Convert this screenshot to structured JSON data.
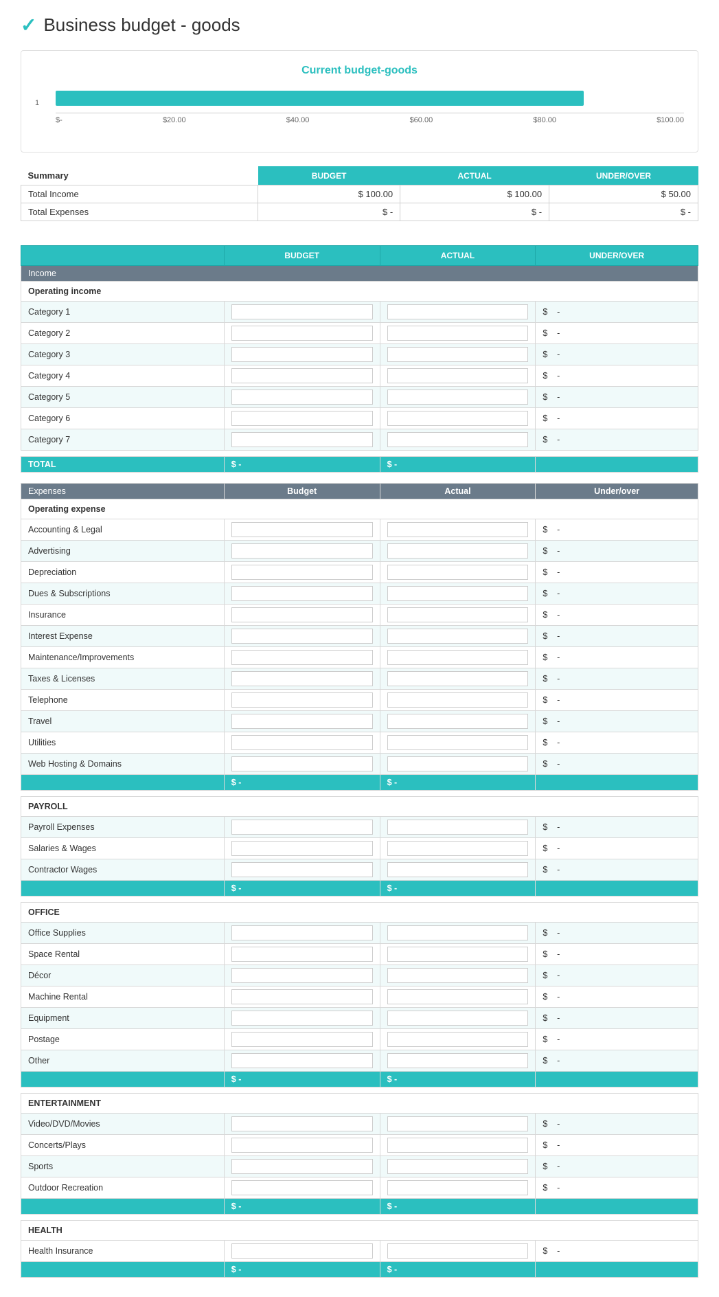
{
  "page": {
    "title": "Business budget - goods",
    "logo_icon": "✓"
  },
  "chart": {
    "title": "Current budget-goods",
    "bar_width_pct": 84,
    "y_label": "1",
    "x_labels": [
      "$-",
      "$20.00",
      "$40.00",
      "$60.00",
      "$80.00",
      "$100.00"
    ]
  },
  "summary": {
    "headers": [
      "",
      "BUDGET",
      "ACTUAL",
      "UNDER/OVER"
    ],
    "label": "Summary",
    "rows": [
      {
        "label": "Total Income",
        "budget": "$ 100.00",
        "actual": "$ 100.00",
        "under_over": "$ 50.00"
      },
      {
        "label": "Total Expenses",
        "budget": "$   -",
        "actual": "$   -",
        "under_over": "$   -"
      }
    ]
  },
  "income_table": {
    "headers": [
      "",
      "BUDGET",
      "ACTUAL",
      "UNDER/OVER"
    ],
    "section_label": "Income",
    "sub_header": "Operating income",
    "categories": [
      "Category 1",
      "Category 2",
      "Category 3",
      "Category 4",
      "Category 5",
      "Category 6",
      "Category 7"
    ],
    "total_label": "TOTAL",
    "total_budget": "$ -",
    "total_actual": "$ -"
  },
  "expenses_table": {
    "section_label": "Expenses",
    "col_budget": "Budget",
    "col_actual": "Actual",
    "col_under_over": "Under/over",
    "groups": [
      {
        "header": "Operating expense",
        "items": [
          "Accounting & Legal",
          "Advertising",
          "Depreciation",
          "Dues & Subscriptions",
          "Insurance",
          "Interest Expense",
          "Maintenance/Improvements",
          "Taxes & Licenses",
          "Telephone",
          "Travel",
          "Utilities",
          "Web Hosting & Domains"
        ],
        "total_budget": "$ -",
        "total_actual": "$ -"
      },
      {
        "header": "PAYROLL",
        "items": [
          "Payroll Expenses",
          "Salaries & Wages",
          "Contractor Wages"
        ],
        "total_budget": "$ -",
        "total_actual": "$ -"
      },
      {
        "header": "OFFICE",
        "items": [
          "Office Supplies",
          "Space Rental",
          "Décor",
          "Machine Rental",
          "Equipment",
          "Postage",
          "Other"
        ],
        "total_budget": "$ -",
        "total_actual": "$ -"
      },
      {
        "header": "ENTERTAINMENT",
        "items": [
          "Video/DVD/Movies",
          "Concerts/Plays",
          "Sports",
          "Outdoor Recreation"
        ],
        "total_budget": "$ -",
        "total_actual": "$ -"
      },
      {
        "header": "HEALTH",
        "items": [
          "Health Insurance"
        ],
        "total_budget": "$ -",
        "total_actual": "$ -"
      }
    ]
  }
}
